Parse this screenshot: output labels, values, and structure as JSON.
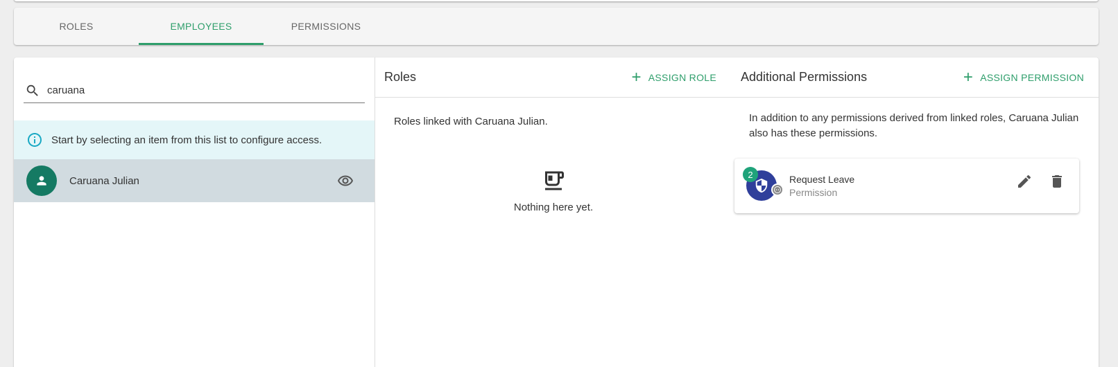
{
  "tabs": [
    {
      "label": "ROLES"
    },
    {
      "label": "EMPLOYEES",
      "active": true
    },
    {
      "label": "PERMISSIONS"
    }
  ],
  "search": {
    "value": "caruana"
  },
  "info": {
    "text": "Start by selecting an item from this list to configure access."
  },
  "employees": [
    {
      "name": "Caruana Julian"
    }
  ],
  "roles": {
    "title": "Roles",
    "assign_label": "ASSIGN ROLE",
    "description": "Roles linked with Caruana Julian.",
    "empty_text": "Nothing here yet."
  },
  "permissions": {
    "title": "Additional Permissions",
    "assign_label": "ASSIGN PERMISSION",
    "description": "In addition to any permissions derived from linked roles, Caruana Julian also has these permissions.",
    "items": [
      {
        "name": "Request Leave",
        "type": "Permission",
        "count": "2"
      }
    ]
  },
  "colors": {
    "accent": "#2e9e6b",
    "avatar": "#157a63",
    "permission_icon": "#2f3f9b",
    "info_bg": "#e4f6f8",
    "selected_row": "#d1dbe0"
  },
  "icons": [
    "search-icon",
    "info-icon",
    "person-icon",
    "eye-icon",
    "plus-icon",
    "coffee-cup-icon",
    "shield-icon",
    "face-icon",
    "pencil-icon",
    "trash-icon"
  ]
}
